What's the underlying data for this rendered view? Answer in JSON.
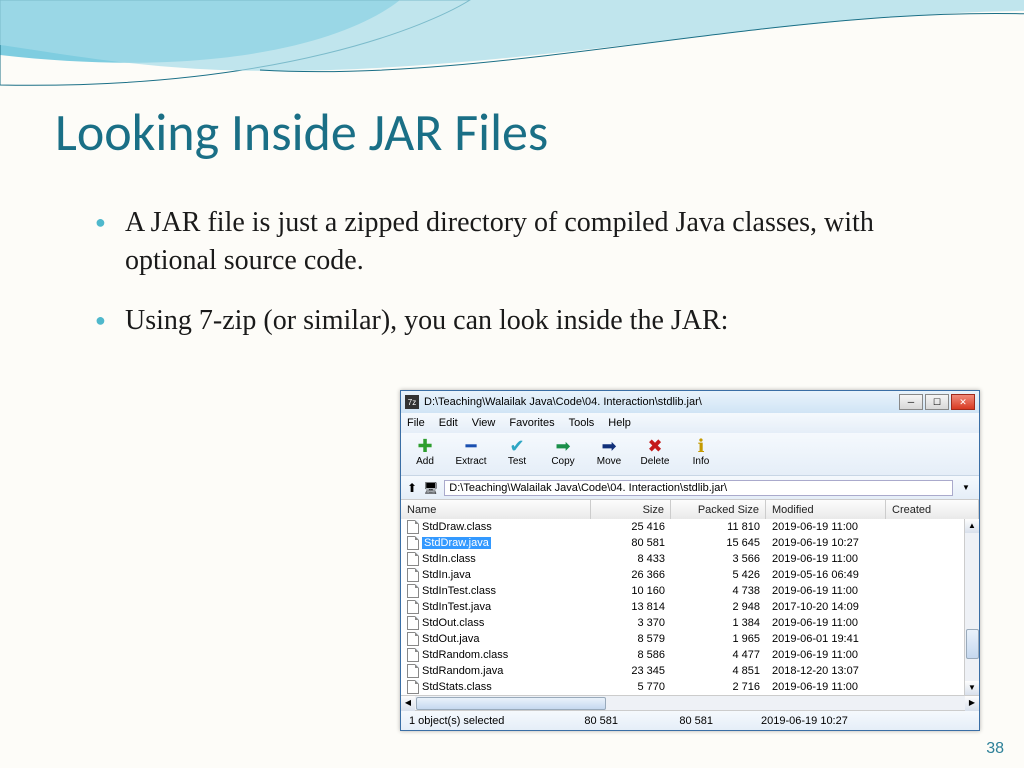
{
  "title": "Looking Inside JAR Files",
  "bullets": [
    "A JAR file is just a zipped directory of compiled Java classes, with optional source code.",
    "Using 7-zip (or similar), you can look inside the JAR:"
  ],
  "page_number": "38",
  "window": {
    "titlebar_label": "7z",
    "titlebar_path": "D:\\Teaching\\Walailak Java\\Code\\04. Interaction\\stdlib.jar\\",
    "menus": [
      "File",
      "Edit",
      "View",
      "Favorites",
      "Tools",
      "Help"
    ],
    "toolbar": [
      {
        "icon": "✚",
        "color": "#2e9e2e",
        "label": "Add"
      },
      {
        "icon": "━",
        "color": "#1a4fb0",
        "label": "Extract"
      },
      {
        "icon": "✔",
        "color": "#2ea6c4",
        "label": "Test"
      },
      {
        "icon": "➡",
        "color": "#1a8f4a",
        "label": "Copy"
      },
      {
        "icon": "➡",
        "color": "#11307a",
        "label": "Move"
      },
      {
        "icon": "✖",
        "color": "#c41a1a",
        "label": "Delete"
      },
      {
        "icon": "ℹ",
        "color": "#c49a00",
        "label": "Info"
      }
    ],
    "path_field": "D:\\Teaching\\Walailak Java\\Code\\04. Interaction\\stdlib.jar\\",
    "columns": [
      "Name",
      "Size",
      "Packed Size",
      "Modified",
      "Created"
    ],
    "rows": [
      {
        "name": "StdDraw.class",
        "size": "25 416",
        "packed": "11 810",
        "mod": "2019-06-19 11:00",
        "sel": false
      },
      {
        "name": "StdDraw.java",
        "size": "80 581",
        "packed": "15 645",
        "mod": "2019-06-19 10:27",
        "sel": true
      },
      {
        "name": "StdIn.class",
        "size": "8 433",
        "packed": "3 566",
        "mod": "2019-06-19 11:00",
        "sel": false
      },
      {
        "name": "StdIn.java",
        "size": "26 366",
        "packed": "5 426",
        "mod": "2019-05-16 06:49",
        "sel": false
      },
      {
        "name": "StdInTest.class",
        "size": "10 160",
        "packed": "4 738",
        "mod": "2019-06-19 11:00",
        "sel": false
      },
      {
        "name": "StdInTest.java",
        "size": "13 814",
        "packed": "2 948",
        "mod": "2017-10-20 14:09",
        "sel": false
      },
      {
        "name": "StdOut.class",
        "size": "3 370",
        "packed": "1 384",
        "mod": "2019-06-19 11:00",
        "sel": false
      },
      {
        "name": "StdOut.java",
        "size": "8 579",
        "packed": "1 965",
        "mod": "2019-06-01 19:41",
        "sel": false
      },
      {
        "name": "StdRandom.class",
        "size": "8 586",
        "packed": "4 477",
        "mod": "2019-06-19 11:00",
        "sel": false
      },
      {
        "name": "StdRandom.java",
        "size": "23 345",
        "packed": "4 851",
        "mod": "2018-12-20 13:07",
        "sel": false
      },
      {
        "name": "StdStats.class",
        "size": "5 770",
        "packed": "2 716",
        "mod": "2019-06-19 11:00",
        "sel": false
      }
    ],
    "status": {
      "selected": "1 object(s) selected",
      "size1": "80 581",
      "size2": "80 581",
      "mod": "2019-06-19 10:27"
    }
  }
}
